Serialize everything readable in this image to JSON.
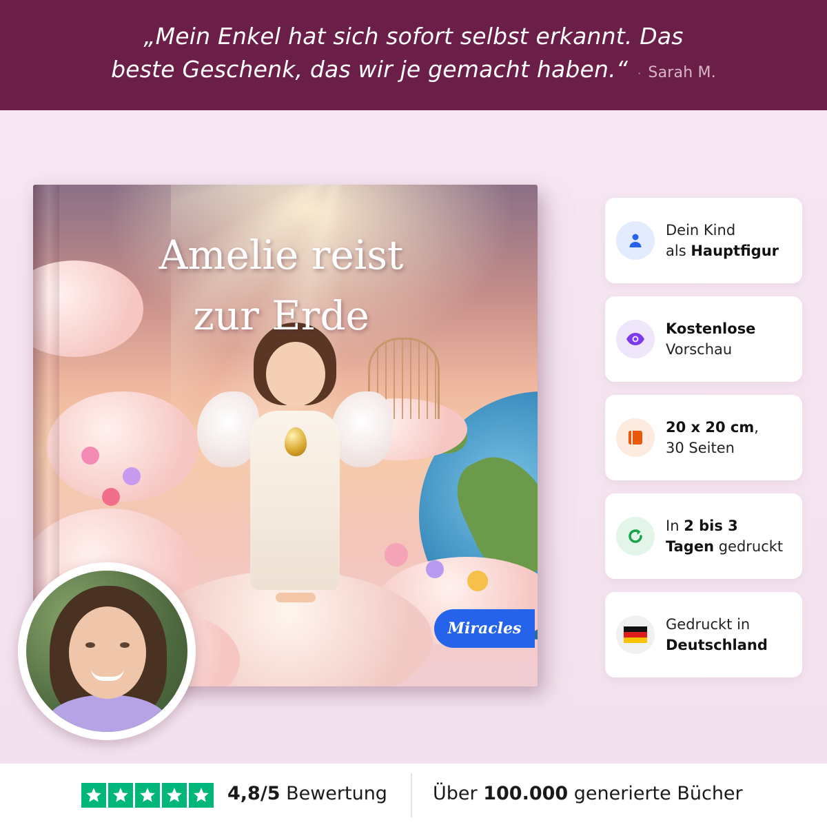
{
  "testimonial": {
    "line1": "„Mein Enkel hat sich sofort selbst erkannt. Das",
    "line2": "beste Geschenk, das wir je gemacht haben.“",
    "separator": "·",
    "author": "Sarah M."
  },
  "book": {
    "title_line1": "Amelie reist",
    "title_line2": "zur Erde",
    "brand": "Miracles"
  },
  "features": [
    {
      "icon": "person-icon",
      "icon_color": "#2563eb",
      "icon_bg": "#e3ecff",
      "text_a": "Dein Kind",
      "text_b_prefix": "als ",
      "text_b_bold": "Hauptfigur",
      "text_b_suffix": ""
    },
    {
      "icon": "eye-icon",
      "icon_color": "#7c3aed",
      "icon_bg": "#efe6fb",
      "text_a_bold": "Kostenlose",
      "text_b": "Vorschau"
    },
    {
      "icon": "book-icon",
      "icon_color": "#ea580c",
      "icon_bg": "#fdebe0",
      "text_a_bold": "20 x 20 cm",
      "text_a_suffix": ",",
      "text_b": "30 Seiten"
    },
    {
      "icon": "refresh-icon",
      "icon_color": "#16a34a",
      "icon_bg": "#e3f5e9",
      "text_a_prefix": "In ",
      "text_a_bold": "2 bis 3",
      "text_b_bold": "Tagen",
      "text_b_suffix": " gedruckt"
    },
    {
      "icon": "germany-flag-icon",
      "icon_bg": "#f1f1f1",
      "text_a": "Gedruckt in",
      "text_b_bold": "Deutschland"
    }
  ],
  "bottom": {
    "rating_value": "4,8/5",
    "rating_label": " Bewertung",
    "books_prefix": "Über ",
    "books_count": "100.000",
    "books_suffix": " generierte Bücher",
    "star_count": 5,
    "star_color": "#00b67a"
  },
  "colors": {
    "banner": "#6b1f48",
    "background": "#f3e4ef",
    "brand_badge": "#2563eb"
  }
}
